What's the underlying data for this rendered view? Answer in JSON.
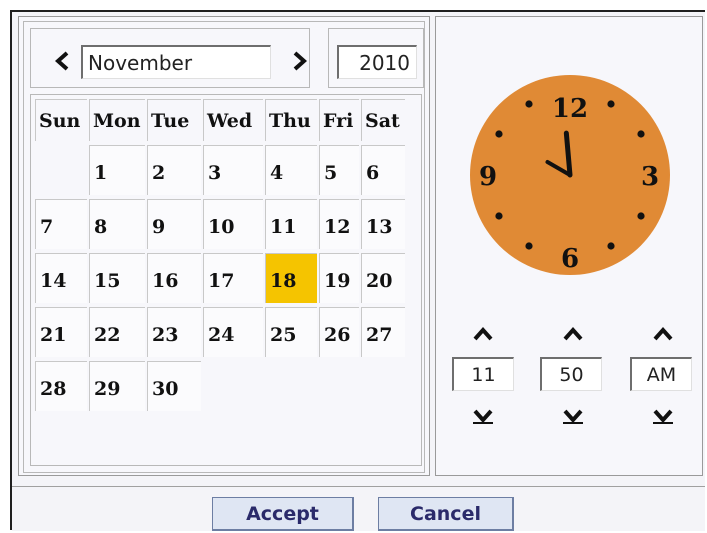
{
  "calendar": {
    "prev_icon": "chevron-left",
    "next_icon": "chevron-right",
    "month": "November",
    "year": "2010",
    "weekdays": [
      "Sun",
      "Mon",
      "Tue",
      "Wed",
      "Thu",
      "Fri",
      "Sat"
    ],
    "weeks": [
      [
        "",
        "1",
        "2",
        "3",
        "4",
        "5",
        "6"
      ],
      [
        "7",
        "8",
        "9",
        "10",
        "11",
        "12",
        "13"
      ],
      [
        "14",
        "15",
        "16",
        "17",
        "18",
        "19",
        "20"
      ],
      [
        "21",
        "22",
        "23",
        "24",
        "25",
        "26",
        "27"
      ],
      [
        "28",
        "29",
        "30",
        "",
        "",
        "",
        ""
      ]
    ],
    "selected_day": "18",
    "selected_color": "#f5c400"
  },
  "clock": {
    "face_color": "#e08a35",
    "numerals": [
      "12",
      "3",
      "6",
      "9"
    ],
    "hour": "11",
    "minute": "50",
    "ampm": "AM",
    "up_icon": "chevron-up",
    "down_icon": "chevron-down"
  },
  "buttons": {
    "accept": "Accept",
    "cancel": "Cancel"
  }
}
